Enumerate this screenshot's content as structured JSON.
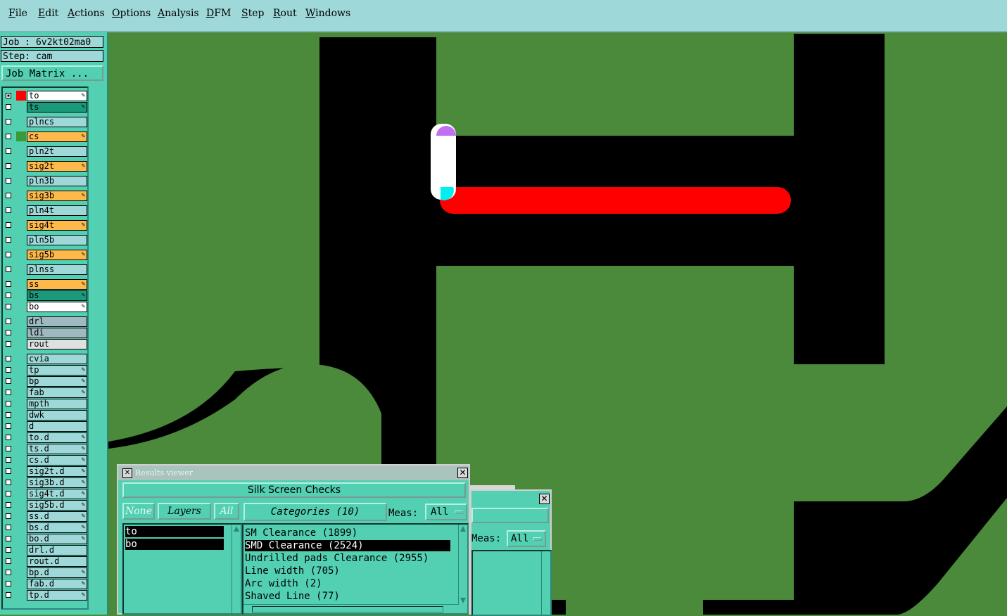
{
  "menu": [
    "File",
    "Edit",
    "Actions",
    "Options",
    "Analysis",
    "DFM",
    "Step",
    "Rout",
    "Windows"
  ],
  "job": "Job : 6v2kt02ma0",
  "step": "Step: cam",
  "job_matrix": "Job Matrix ...",
  "layers": [
    {
      "name": "to",
      "bg": "#ffffff",
      "color": "#ff0000",
      "selected": true,
      "mark": "edit"
    },
    {
      "name": "ts",
      "bg": "#1a9a7a",
      "color": "",
      "mark": "edit"
    },
    {
      "name": "plncs",
      "bg": "#9ed8d8",
      "color": ""
    },
    {
      "name": "cs",
      "bg": "#ffb84a",
      "color": "#3a9a3a",
      "mark": "edit"
    },
    {
      "name": "pln2t",
      "bg": "#9ed8d8",
      "color": ""
    },
    {
      "name": "sig2t",
      "bg": "#ffb84a",
      "color": "",
      "mark": "edit"
    },
    {
      "name": "pln3b",
      "bg": "#9ed8d8",
      "color": ""
    },
    {
      "name": "sig3b",
      "bg": "#ffb84a",
      "color": "",
      "mark": "edit"
    },
    {
      "name": "pln4t",
      "bg": "#9ed8d8",
      "color": ""
    },
    {
      "name": "sig4t",
      "bg": "#ffb84a",
      "color": "",
      "mark": "edit"
    },
    {
      "name": "pln5b",
      "bg": "#9ed8d8",
      "color": ""
    },
    {
      "name": "sig5b",
      "bg": "#ffb84a",
      "color": "",
      "mark": "edit"
    },
    {
      "name": "plnss",
      "bg": "#9ed8d8",
      "color": ""
    },
    {
      "name": "ss",
      "bg": "#ffb84a",
      "color": "",
      "mark": "edit"
    },
    {
      "name": "bs",
      "bg": "#1a9a7a",
      "color": "",
      "mark": "edit"
    },
    {
      "name": "bo",
      "bg": "#ffffff",
      "color": "",
      "mark": "edit"
    },
    {
      "name": "drl",
      "bg": "#a0b8c0",
      "color": ""
    },
    {
      "name": "ldi",
      "bg": "#a0b8c0",
      "color": ""
    },
    {
      "name": "rout",
      "bg": "#e0e0e0",
      "color": ""
    },
    {
      "name": "cvia",
      "bg": "#9ed8d8",
      "color": ""
    },
    {
      "name": "tp",
      "bg": "#9ed8d8",
      "color": "",
      "mark": "edit"
    },
    {
      "name": "bp",
      "bg": "#9ed8d8",
      "color": "",
      "mark": "edit"
    },
    {
      "name": "fab",
      "bg": "#9ed8d8",
      "color": "",
      "mark": "edit"
    },
    {
      "name": "mpth",
      "bg": "#9ed8d8",
      "color": ""
    },
    {
      "name": "dwk",
      "bg": "#9ed8d8",
      "color": ""
    },
    {
      "name": "d",
      "bg": "#9ed8d8",
      "color": ""
    },
    {
      "name": "to.d",
      "bg": "#9ed8d8",
      "color": "",
      "mark": "edit"
    },
    {
      "name": "ts.d",
      "bg": "#9ed8d8",
      "color": "",
      "mark": "edit"
    },
    {
      "name": "cs.d",
      "bg": "#9ed8d8",
      "color": "",
      "mark": "edit"
    },
    {
      "name": "sig2t.d",
      "bg": "#9ed8d8",
      "color": "",
      "mark": "edit"
    },
    {
      "name": "sig3b.d",
      "bg": "#9ed8d8",
      "color": "",
      "mark": "edit"
    },
    {
      "name": "sig4t.d",
      "bg": "#9ed8d8",
      "color": "",
      "mark": "edit"
    },
    {
      "name": "sig5b.d",
      "bg": "#9ed8d8",
      "color": "",
      "mark": "edit"
    },
    {
      "name": "ss.d",
      "bg": "#9ed8d8",
      "color": "",
      "mark": "edit"
    },
    {
      "name": "bs.d",
      "bg": "#9ed8d8",
      "color": "",
      "mark": "edit"
    },
    {
      "name": "bo.d",
      "bg": "#9ed8d8",
      "color": "",
      "mark": "edit"
    },
    {
      "name": "drl.d",
      "bg": "#9ed8d8",
      "color": ""
    },
    {
      "name": "rout.d",
      "bg": "#9ed8d8",
      "color": ""
    },
    {
      "name": "bp.d",
      "bg": "#9ed8d8",
      "color": "",
      "mark": "edit"
    },
    {
      "name": "fab.d",
      "bg": "#9ed8d8",
      "color": "",
      "mark": "edit"
    },
    {
      "name": "tp.d",
      "bg": "#9ed8d8",
      "color": "",
      "mark": "edit"
    }
  ],
  "results_viewer": {
    "title": "Results viewer",
    "subtitle": "Silk Screen Checks",
    "none_label": "None",
    "layers_label": "Layers",
    "all_label": "All",
    "categories_label": "Categories (10)",
    "meas_label": "Meas:",
    "meas_value": "All",
    "layer_items": [
      "to",
      "bo"
    ],
    "categories": [
      {
        "label": "SM Clearance (1899)",
        "selected": false
      },
      {
        "label": "SMD Clearance (2524)",
        "selected": true
      },
      {
        "label": "Undrilled pads Clearance (2955)",
        "selected": false
      },
      {
        "label": "Line width (705)",
        "selected": false
      },
      {
        "label": "Arc width (2)",
        "selected": false
      },
      {
        "label": "Shaved Line (77)",
        "selected": false
      }
    ]
  },
  "results_viewer_back": {
    "meas_label": "Meas:",
    "meas_value": "All"
  },
  "colors": {
    "board_green": "#4a8a3a",
    "copper_black": "#000000",
    "highlight_red": "#ff0000",
    "panel_teal": "#53cfb1",
    "menu_bg": "#9ed8d8"
  }
}
